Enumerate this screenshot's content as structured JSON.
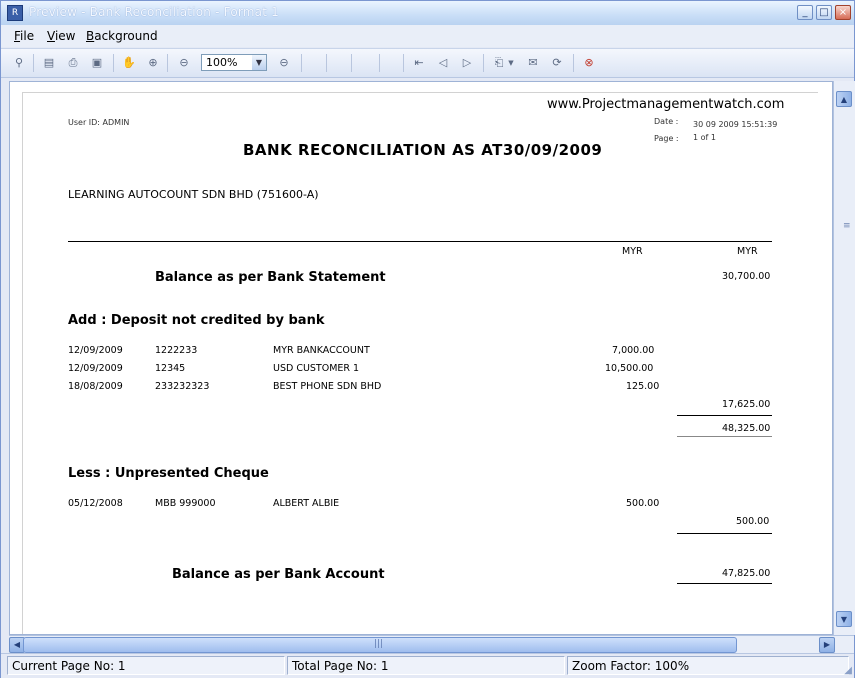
{
  "window": {
    "title": "Preview - Bank Reconciliation - Format 1",
    "minimize_glyph": "_",
    "maximize_glyph": "□",
    "close_glyph": "×"
  },
  "menu": {
    "file": {
      "mnemonic": "F",
      "rest": "ile"
    },
    "view": {
      "mnemonic": "V",
      "rest": "iew"
    },
    "background": {
      "mnemonic": "B",
      "rest": "ackground"
    }
  },
  "toolbar": {
    "zoom_value": "100%",
    "icons": [
      "binoculars-icon",
      "open-icon",
      "print-icon",
      "print-setup-icon",
      "hand-icon",
      "zoom-in-icon",
      "zoom-out-icon",
      "zoom-out-2-icon",
      "first-page-icon",
      "prev-page-icon",
      "next-page-icon",
      "export-icon",
      "dropdown-arrow-icon",
      "email-icon",
      "refresh-icon",
      "close-report-icon"
    ]
  },
  "report": {
    "watermark": "www.Projectmanagementwatch.com",
    "user_id": "User ID:  ADMIN",
    "date_label": "Date :",
    "date_value": "30 09 2009 15:51:39",
    "page_label": "Page :",
    "page_value": "1 of 1",
    "title": "BANK  RECONCILIATION  AS  AT30/09/2009",
    "company": "LEARNING AUTOCOUNT SDN BHD (751600-A)",
    "currency_col1": "MYR",
    "currency_col2": "MYR",
    "balance_bank_label": "Balance as per Bank Statement",
    "balance_bank_value": "30,700.00",
    "add_heading": "Add : Deposit not credited by bank",
    "deposits": [
      {
        "date": "12/09/2009",
        "ref": "1222233",
        "desc": "MYR BANKACCOUNT",
        "amount": "7,000.00"
      },
      {
        "date": "12/09/2009",
        "ref": "12345",
        "desc": "USD CUSTOMER 1",
        "amount": "10,500.00"
      },
      {
        "date": "18/08/2009",
        "ref": "233232323",
        "desc": "BEST PHONE SDN BHD",
        "amount": "125.00"
      }
    ],
    "deposits_total": "17,625.00",
    "subtotal": "48,325.00",
    "less_heading": "Less : Unpresented Cheque",
    "cheques": [
      {
        "date": "05/12/2008",
        "ref": "MBB 999000",
        "desc": "ALBERT ALBIE",
        "amount": "500.00"
      }
    ],
    "cheques_total": "500.00",
    "balance_account_label": "Balance as per Bank Account",
    "balance_account_value": "47,825.00"
  },
  "status": {
    "current_page": "Current Page No: 1",
    "total_page": "Total Page No: 1",
    "zoom_factor": "Zoom Factor: 100%"
  }
}
